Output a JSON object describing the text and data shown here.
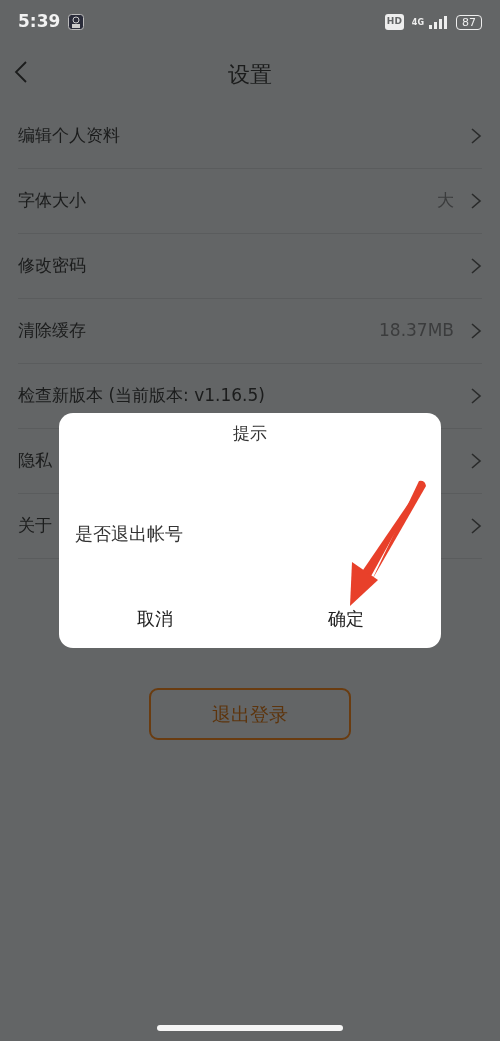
{
  "status_bar": {
    "time": "5:39",
    "hd": "HD",
    "network": "4G",
    "battery": "87"
  },
  "header": {
    "title": "设置"
  },
  "settings": [
    {
      "label": "编辑个人资料"
    },
    {
      "label": "字体大小",
      "value": "大"
    },
    {
      "label": "修改密码"
    },
    {
      "label": "清除缓存",
      "value": "18.37MB"
    },
    {
      "label": "检查新版本 (当前版本: v1.16.5)"
    },
    {
      "label": "隐私"
    },
    {
      "label": "关于"
    }
  ],
  "logout_button": "退出登录",
  "dialog": {
    "title": "提示",
    "message": "是否退出帐号",
    "buttons": [
      {
        "label": "取消"
      },
      {
        "label": "确定"
      }
    ]
  }
}
